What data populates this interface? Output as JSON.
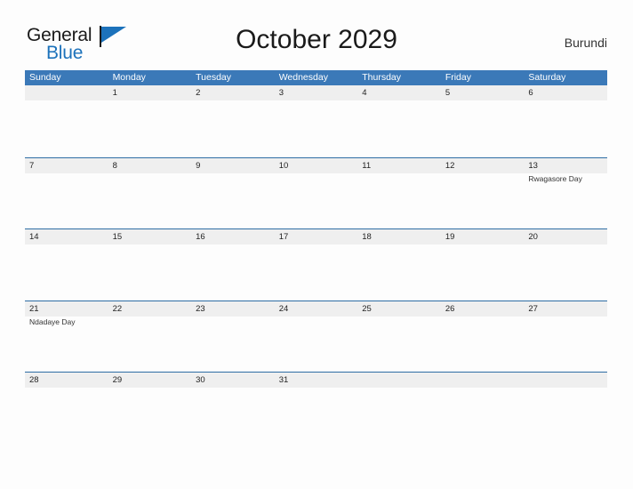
{
  "brand": {
    "name_line1": "General",
    "name_line2": "Blue",
    "flag_icon": "triangle-flag-icon",
    "accent_color": "#1c72bb"
  },
  "header": {
    "title": "October 2029",
    "country": "Burundi"
  },
  "colors": {
    "weekday_header_bg": "#3b79b8",
    "weekday_header_text": "#ffffff",
    "date_band_bg": "#efefef",
    "row_rule": "#2e6da4",
    "page_bg": "#fdfdfd"
  },
  "calendar": {
    "weekdays": [
      "Sunday",
      "Monday",
      "Tuesday",
      "Wednesday",
      "Thursday",
      "Friday",
      "Saturday"
    ],
    "month": "October",
    "year": "2029",
    "weeks": [
      [
        {
          "date": "",
          "event": ""
        },
        {
          "date": "1",
          "event": ""
        },
        {
          "date": "2",
          "event": ""
        },
        {
          "date": "3",
          "event": ""
        },
        {
          "date": "4",
          "event": ""
        },
        {
          "date": "5",
          "event": ""
        },
        {
          "date": "6",
          "event": ""
        }
      ],
      [
        {
          "date": "7",
          "event": ""
        },
        {
          "date": "8",
          "event": ""
        },
        {
          "date": "9",
          "event": ""
        },
        {
          "date": "10",
          "event": ""
        },
        {
          "date": "11",
          "event": ""
        },
        {
          "date": "12",
          "event": ""
        },
        {
          "date": "13",
          "event": "Rwagasore Day"
        }
      ],
      [
        {
          "date": "14",
          "event": ""
        },
        {
          "date": "15",
          "event": ""
        },
        {
          "date": "16",
          "event": ""
        },
        {
          "date": "17",
          "event": ""
        },
        {
          "date": "18",
          "event": ""
        },
        {
          "date": "19",
          "event": ""
        },
        {
          "date": "20",
          "event": ""
        }
      ],
      [
        {
          "date": "21",
          "event": "Ndadaye Day"
        },
        {
          "date": "22",
          "event": ""
        },
        {
          "date": "23",
          "event": ""
        },
        {
          "date": "24",
          "event": ""
        },
        {
          "date": "25",
          "event": ""
        },
        {
          "date": "26",
          "event": ""
        },
        {
          "date": "27",
          "event": ""
        }
      ],
      [
        {
          "date": "28",
          "event": ""
        },
        {
          "date": "29",
          "event": ""
        },
        {
          "date": "30",
          "event": ""
        },
        {
          "date": "31",
          "event": ""
        },
        {
          "date": "",
          "event": ""
        },
        {
          "date": "",
          "event": ""
        },
        {
          "date": "",
          "event": ""
        }
      ]
    ]
  }
}
